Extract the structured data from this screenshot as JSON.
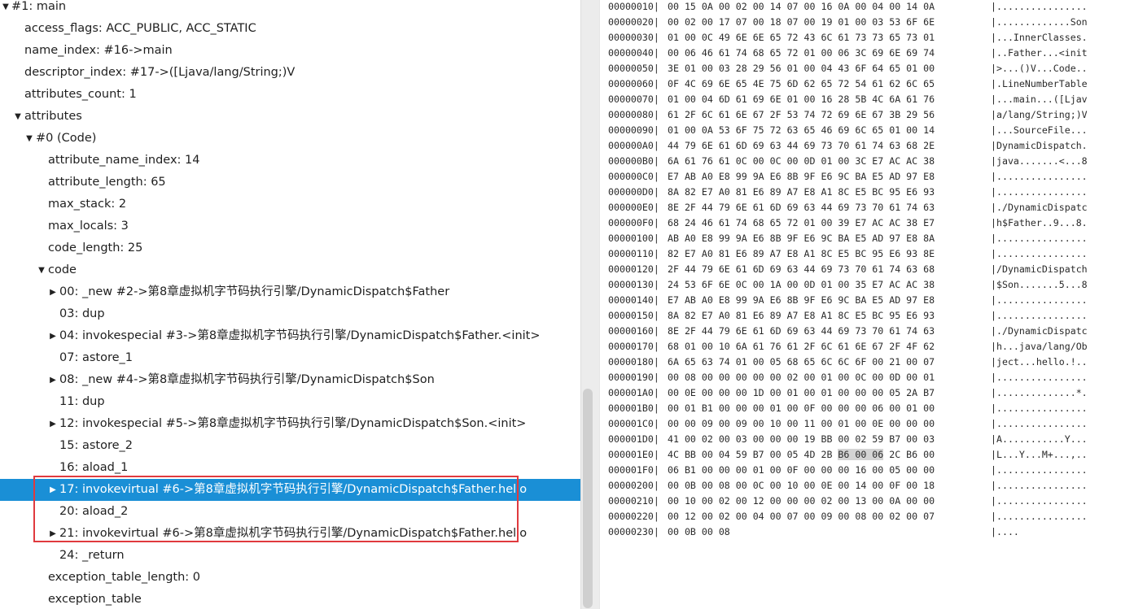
{
  "tree": [
    {
      "text": "#1: main",
      "depth": 0,
      "toggle": "down"
    },
    {
      "text": "access_flags: ACC_PUBLIC, ACC_STATIC",
      "depth": 1,
      "toggle": "none"
    },
    {
      "text": "name_index: #16->main",
      "depth": 1,
      "toggle": "none"
    },
    {
      "text": "descriptor_index: #17->([Ljava/lang/String;)V",
      "depth": 1,
      "toggle": "none"
    },
    {
      "text": "attributes_count: 1",
      "depth": 1,
      "toggle": "none"
    },
    {
      "text": "attributes",
      "depth": 1,
      "toggle": "down"
    },
    {
      "text": "#0 (Code)",
      "depth": 2,
      "toggle": "down"
    },
    {
      "text": "attribute_name_index: 14",
      "depth": 3,
      "toggle": "none"
    },
    {
      "text": "attribute_length: 65",
      "depth": 3,
      "toggle": "none"
    },
    {
      "text": "max_stack: 2",
      "depth": 3,
      "toggle": "none"
    },
    {
      "text": "max_locals: 3",
      "depth": 3,
      "toggle": "none"
    },
    {
      "text": "code_length: 25",
      "depth": 3,
      "toggle": "none"
    },
    {
      "text": "code",
      "depth": 3,
      "toggle": "down"
    },
    {
      "text": "00: _new #2->第8章虚拟机字节码执行引擎/DynamicDispatch$Father",
      "depth": 4,
      "toggle": "right"
    },
    {
      "text": "03: dup",
      "depth": 4,
      "toggle": "none"
    },
    {
      "text": "04: invokespecial #3->第8章虚拟机字节码执行引擎/DynamicDispatch$Father.<init>",
      "depth": 4,
      "toggle": "right"
    },
    {
      "text": "07: astore_1",
      "depth": 4,
      "toggle": "none"
    },
    {
      "text": "08: _new #4->第8章虚拟机字节码执行引擎/DynamicDispatch$Son",
      "depth": 4,
      "toggle": "right"
    },
    {
      "text": "11: dup",
      "depth": 4,
      "toggle": "none"
    },
    {
      "text": "12: invokespecial #5->第8章虚拟机字节码执行引擎/DynamicDispatch$Son.<init>",
      "depth": 4,
      "toggle": "right"
    },
    {
      "text": "15: astore_2",
      "depth": 4,
      "toggle": "none"
    },
    {
      "text": "16: aload_1",
      "depth": 4,
      "toggle": "none"
    },
    {
      "text": "17: invokevirtual #6->第8章虚拟机字节码执行引擎/DynamicDispatch$Father.hello",
      "depth": 4,
      "toggle": "right",
      "selected": true
    },
    {
      "text": "20: aload_2",
      "depth": 4,
      "toggle": "none"
    },
    {
      "text": "21: invokevirtual #6->第8章虚拟机字节码执行引擎/DynamicDispatch$Father.hello",
      "depth": 4,
      "toggle": "right"
    },
    {
      "text": "24: _return",
      "depth": 4,
      "toggle": "none"
    },
    {
      "text": "exception_table_length: 0",
      "depth": 3,
      "toggle": "none"
    },
    {
      "text": "exception_table",
      "depth": 3,
      "toggle": "none"
    }
  ],
  "hex": [
    {
      "offset": "00000010|",
      "bytes": "00 15 0A 00 02 00 14 07 00 16 0A 00 04 00 14 0A",
      "ascii": "|................"
    },
    {
      "offset": "00000020|",
      "bytes": "00 02 00 17 07 00 18 07 00 19 01 00 03 53 6F 6E",
      "ascii": "|.............Son"
    },
    {
      "offset": "00000030|",
      "bytes": "01 00 0C 49 6E 6E 65 72 43 6C 61 73 73 65 73 01",
      "ascii": "|...InnerClasses."
    },
    {
      "offset": "00000040|",
      "bytes": "00 06 46 61 74 68 65 72 01 00 06 3C 69 6E 69 74",
      "ascii": "|..Father...<init"
    },
    {
      "offset": "00000050|",
      "bytes": "3E 01 00 03 28 29 56 01 00 04 43 6F 64 65 01 00",
      "ascii": "|>...()V...Code.."
    },
    {
      "offset": "00000060|",
      "bytes": "0F 4C 69 6E 65 4E 75 6D 62 65 72 54 61 62 6C 65",
      "ascii": "|.LineNumberTable"
    },
    {
      "offset": "00000070|",
      "bytes": "01 00 04 6D 61 69 6E 01 00 16 28 5B 4C 6A 61 76",
      "ascii": "|...main...([Ljav"
    },
    {
      "offset": "00000080|",
      "bytes": "61 2F 6C 61 6E 67 2F 53 74 72 69 6E 67 3B 29 56",
      "ascii": "|a/lang/String;)V"
    },
    {
      "offset": "00000090|",
      "bytes": "01 00 0A 53 6F 75 72 63 65 46 69 6C 65 01 00 14",
      "ascii": "|...SourceFile..."
    },
    {
      "offset": "000000A0|",
      "bytes": "44 79 6E 61 6D 69 63 44 69 73 70 61 74 63 68 2E",
      "ascii": "|DynamicDispatch."
    },
    {
      "offset": "000000B0|",
      "bytes": "6A 61 76 61 0C 00 0C 00 0D 01 00 3C E7 AC AC 38",
      "ascii": "|java.......<...8"
    },
    {
      "offset": "000000C0|",
      "bytes": "E7 AB A0 E8 99 9A E6 8B 9F E6 9C BA E5 AD 97 E8",
      "ascii": "|................"
    },
    {
      "offset": "000000D0|",
      "bytes": "8A 82 E7 A0 81 E6 89 A7 E8 A1 8C E5 BC 95 E6 93",
      "ascii": "|................"
    },
    {
      "offset": "000000E0|",
      "bytes": "8E 2F 44 79 6E 61 6D 69 63 44 69 73 70 61 74 63",
      "ascii": "|./DynamicDispatc"
    },
    {
      "offset": "000000F0|",
      "bytes": "68 24 46 61 74 68 65 72 01 00 39 E7 AC AC 38 E7",
      "ascii": "|h$Father..9...8."
    },
    {
      "offset": "00000100|",
      "bytes": "AB A0 E8 99 9A E6 8B 9F E6 9C BA E5 AD 97 E8 8A",
      "ascii": "|................"
    },
    {
      "offset": "00000110|",
      "bytes": "82 E7 A0 81 E6 89 A7 E8 A1 8C E5 BC 95 E6 93 8E",
      "ascii": "|................"
    },
    {
      "offset": "00000120|",
      "bytes": "2F 44 79 6E 61 6D 69 63 44 69 73 70 61 74 63 68",
      "ascii": "|/DynamicDispatch"
    },
    {
      "offset": "00000130|",
      "bytes": "24 53 6F 6E 0C 00 1A 00 0D 01 00 35 E7 AC AC 38",
      "ascii": "|$Son.......5...8"
    },
    {
      "offset": "00000140|",
      "bytes": "E7 AB A0 E8 99 9A E6 8B 9F E6 9C BA E5 AD 97 E8",
      "ascii": "|................"
    },
    {
      "offset": "00000150|",
      "bytes": "8A 82 E7 A0 81 E6 89 A7 E8 A1 8C E5 BC 95 E6 93",
      "ascii": "|................"
    },
    {
      "offset": "00000160|",
      "bytes": "8E 2F 44 79 6E 61 6D 69 63 44 69 73 70 61 74 63",
      "ascii": "|./DynamicDispatc"
    },
    {
      "offset": "00000170|",
      "bytes": "68 01 00 10 6A 61 76 61 2F 6C 61 6E 67 2F 4F 62",
      "ascii": "|h...java/lang/Ob"
    },
    {
      "offset": "00000180|",
      "bytes": "6A 65 63 74 01 00 05 68 65 6C 6C 6F 00 21 00 07",
      "ascii": "|ject...hello.!.."
    },
    {
      "offset": "00000190|",
      "bytes": "00 08 00 00 00 00 00 02 00 01 00 0C 00 0D 00 01",
      "ascii": "|................"
    },
    {
      "offset": "000001A0|",
      "bytes": "00 0E 00 00 00 1D 00 01 00 01 00 00 00 05 2A B7",
      "ascii": "|..............*."
    },
    {
      "offset": "000001B0|",
      "bytes": "00 01 B1 00 00 00 01 00 0F 00 00 00 06 00 01 00",
      "ascii": "|................"
    },
    {
      "offset": "000001C0|",
      "bytes": "00 00 09 00 09 00 10 00 11 00 01 00 0E 00 00 00",
      "ascii": "|................"
    },
    {
      "offset": "000001D0|",
      "bytes": "41 00 02 00 03 00 00 00 19 BB 00 02 59 B7 00 03",
      "ascii": "|A...........Y..."
    },
    {
      "offset": "000001E0|",
      "bytes": "4C BB 00 04 59 B7 00 05 4D 2B B6 00 06 2C B6 00",
      "ascii": "|L...Y...M+...,..",
      "hl": true
    },
    {
      "offset": "000001F0|",
      "bytes": "06 B1 00 00 00 01 00 0F 00 00 00 16 00 05 00 00",
      "ascii": "|................"
    },
    {
      "offset": "00000200|",
      "bytes": "00 0B 00 08 00 0C 00 10 00 0E 00 14 00 0F 00 18",
      "ascii": "|................"
    },
    {
      "offset": "00000210|",
      "bytes": "00 10 00 02 00 12 00 00 00 02 00 13 00 0A 00 00",
      "ascii": "|................"
    },
    {
      "offset": "00000220|",
      "bytes": "00 12 00 02 00 04 00 07 00 09 00 08 00 02 00 07",
      "ascii": "|................"
    },
    {
      "offset": "00000230|",
      "bytes": "00 0B 00 08",
      "ascii": "|...."
    }
  ],
  "highlight_bytes": "B6 00 06"
}
